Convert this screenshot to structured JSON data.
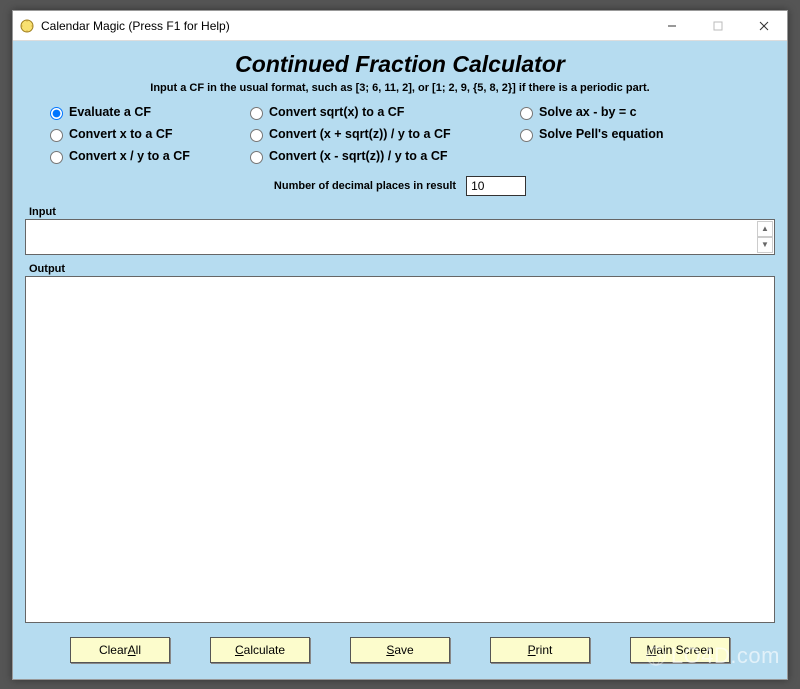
{
  "titlebar": {
    "text": "Calendar Magic (Press F1 for Help)"
  },
  "main": {
    "title": "Continued Fraction Calculator",
    "instructions": "Input a CF in the usual format, such as [3; 6, 11, 2], or [1; 2, 9, {5, 8, 2}] if there is a periodic part."
  },
  "radios": {
    "r1": "Evaluate a CF",
    "r2": "Convert sqrt(x) to a CF",
    "r3": "Solve ax - by = c",
    "r4": "Convert x to a CF",
    "r5": "Convert (x + sqrt(z)) / y to a CF",
    "r6": "Solve Pell's equation",
    "r7": "Convert x / y to a CF",
    "r8": "Convert (x - sqrt(z)) / y to a CF"
  },
  "decimals": {
    "label": "Number of decimal places in result",
    "value": "10"
  },
  "labels": {
    "input": "Input",
    "output": "Output"
  },
  "buttons": {
    "clear_pre": "Clear ",
    "clear_u": "A",
    "clear_post": "ll",
    "calc_u": "C",
    "calc_post": "alculate",
    "save_u": "S",
    "save_post": "ave",
    "print_u": "P",
    "print_post": "rint",
    "main_u": "M",
    "main_post": "ain Screen"
  },
  "watermark": "LO4D.com"
}
